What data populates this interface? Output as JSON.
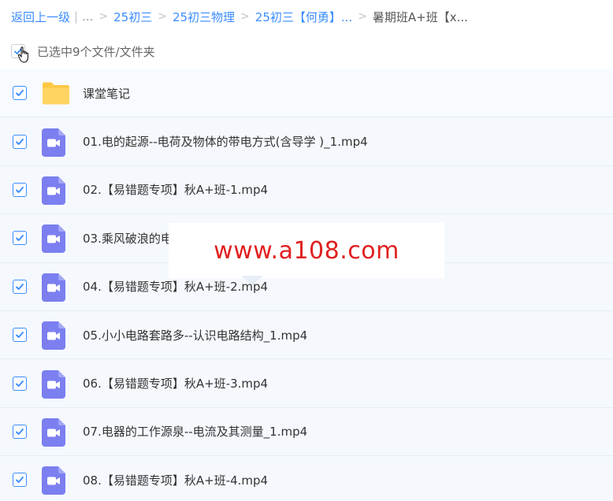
{
  "breadcrumb": {
    "back": "返回上一级",
    "divider": "|",
    "ellipsis": "...",
    "sep": ">",
    "items": [
      {
        "label": "25初三"
      },
      {
        "label": "25初三物理"
      },
      {
        "label": "25初三【何勇】..."
      }
    ],
    "current": "暑期班A+班【x..."
  },
  "selection": {
    "text": "已选中9个文件/文件夹"
  },
  "files": [
    {
      "name": "课堂笔记",
      "type": "folder",
      "icon": "folder-icon",
      "checked": true
    },
    {
      "name": "01.电的起源--电荷及物体的带电方式(含导学 )_1.mp4",
      "type": "video",
      "icon": "video-icon",
      "checked": true
    },
    {
      "name": "02.【易错题专项】秋A+班-1.mp4",
      "type": "video",
      "icon": "video-icon",
      "checked": true
    },
    {
      "name": "03.乘风破浪的电",
      "type": "video",
      "icon": "video-icon",
      "checked": true
    },
    {
      "name": "04.【易错题专项】秋A+班-2.mp4",
      "type": "video",
      "icon": "video-icon",
      "checked": true
    },
    {
      "name": "05.小小电路套路多--认识电路结构_1.mp4",
      "type": "video",
      "icon": "video-icon",
      "checked": true
    },
    {
      "name": "06.【易错题专项】秋A+班-3.mp4",
      "type": "video",
      "icon": "video-icon",
      "checked": true
    },
    {
      "name": "07.电器的工作源泉--电流及其测量_1.mp4",
      "type": "video",
      "icon": "video-icon",
      "checked": true
    },
    {
      "name": "08.【易错题专项】秋A+班-4.mp4",
      "type": "video",
      "icon": "video-icon",
      "checked": true
    }
  ],
  "watermark": {
    "text": "www.a108.com"
  },
  "colors": {
    "accent": "#3b8cff",
    "video_icon": "#7b7ff0",
    "folder_icon": "#ffc845",
    "watermark_text": "#e02020"
  }
}
